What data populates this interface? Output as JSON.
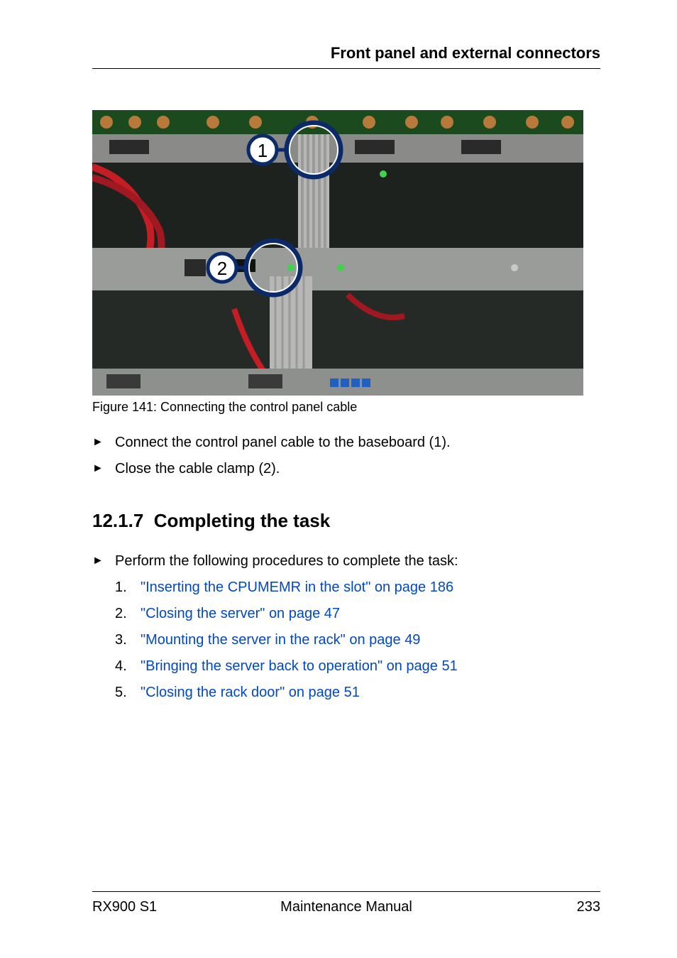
{
  "header": {
    "title": "Front panel and external connectors"
  },
  "figure": {
    "caption": "Figure 141: Connecting the control panel cable",
    "callouts": {
      "one": "1",
      "two": "2"
    }
  },
  "bullets": {
    "b1": "Connect the control panel cable to the baseboard (1).",
    "b2": "Close the cable clamp (2).",
    "b3": "Perform the following procedures to complete the task:"
  },
  "section": {
    "number": "12.1.7",
    "title": "Completing the task"
  },
  "procedures": [
    {
      "n": "1.",
      "text": "\"Inserting the CPUMEMR in the slot\" on page 186"
    },
    {
      "n": "2.",
      "text": "\"Closing the server\" on page 47"
    },
    {
      "n": "3.",
      "text": "\"Mounting the server in the rack\" on page 49"
    },
    {
      "n": "4.",
      "text": "\"Bringing the server back to operation\" on page 51"
    },
    {
      "n": "5.",
      "text": "\"Closing the rack door\" on page 51"
    }
  ],
  "footer": {
    "left": "RX900 S1",
    "center": "Maintenance Manual",
    "right": "233"
  }
}
